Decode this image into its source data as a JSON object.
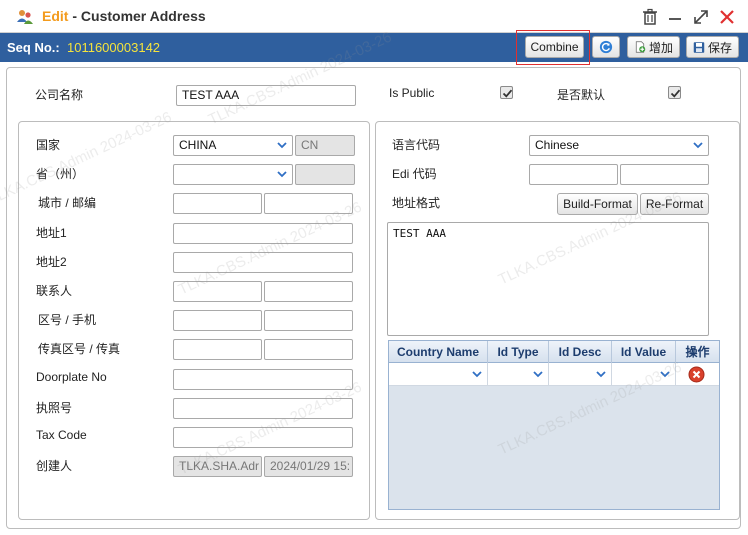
{
  "title": {
    "mode": "Edit",
    "separator": " - ",
    "text": "Customer Address"
  },
  "seq": {
    "label": "Seq No.:",
    "value": "1011600003142"
  },
  "toolbar": {
    "combine": "Combine",
    "add": "增加",
    "save": "保存"
  },
  "top": {
    "company_label": "公司名称",
    "company_value": "TEST AAA",
    "is_public_label": "Is Public",
    "is_public_checked": true,
    "is_default_label": "是否默认",
    "is_default_checked": true
  },
  "left": {
    "country_label": "国家",
    "country_value": "CHINA",
    "country_code": "CN",
    "province_label": "省（州）",
    "province_value": "",
    "province_code": "",
    "city_label": "城市 / 邮编",
    "city_value": "",
    "zip_value": "",
    "addr1_label": "地址1",
    "addr1_value": "",
    "addr2_label": "地址2",
    "addr2_value": "",
    "contact_label": "联系人",
    "contact_value": "",
    "contact_value2": "",
    "phone_label": "区号 / 手机",
    "area_code": "",
    "mobile": "",
    "fax_label": "传真区号 / 传真",
    "fax_area": "",
    "fax": "",
    "doorplate_label": "Doorplate No",
    "doorplate_value": "",
    "license_label": "执照号",
    "license_value": "",
    "tax_label": "Tax Code",
    "tax_value": "",
    "creator_label": "创建人",
    "creator_value": "TLKA.SHA.Adr",
    "created_at": "2024/01/29 15:"
  },
  "right": {
    "lang_label": "语言代码",
    "lang_value": "Chinese",
    "edi_label": "Edi 代码",
    "edi_value1": "",
    "edi_value2": "",
    "format_label": "地址格式",
    "build_format": "Build-Format",
    "re_format": "Re-Format",
    "format_text": "TEST AAA"
  },
  "grid": {
    "columns": [
      "Country Name",
      "Id Type",
      "Id Desc",
      "Id Value",
      "操作"
    ],
    "rows": [
      {
        "country": "",
        "id_type": "",
        "id_desc": "",
        "id_value": ""
      }
    ]
  },
  "watermark": "TLKA.CBS.Admin 2024-03-26",
  "colors": {
    "header_bar": "#2f5f9e",
    "seq_value": "#f5e33c",
    "edit_accent": "#f39b1d",
    "close_red": "#e03030"
  }
}
